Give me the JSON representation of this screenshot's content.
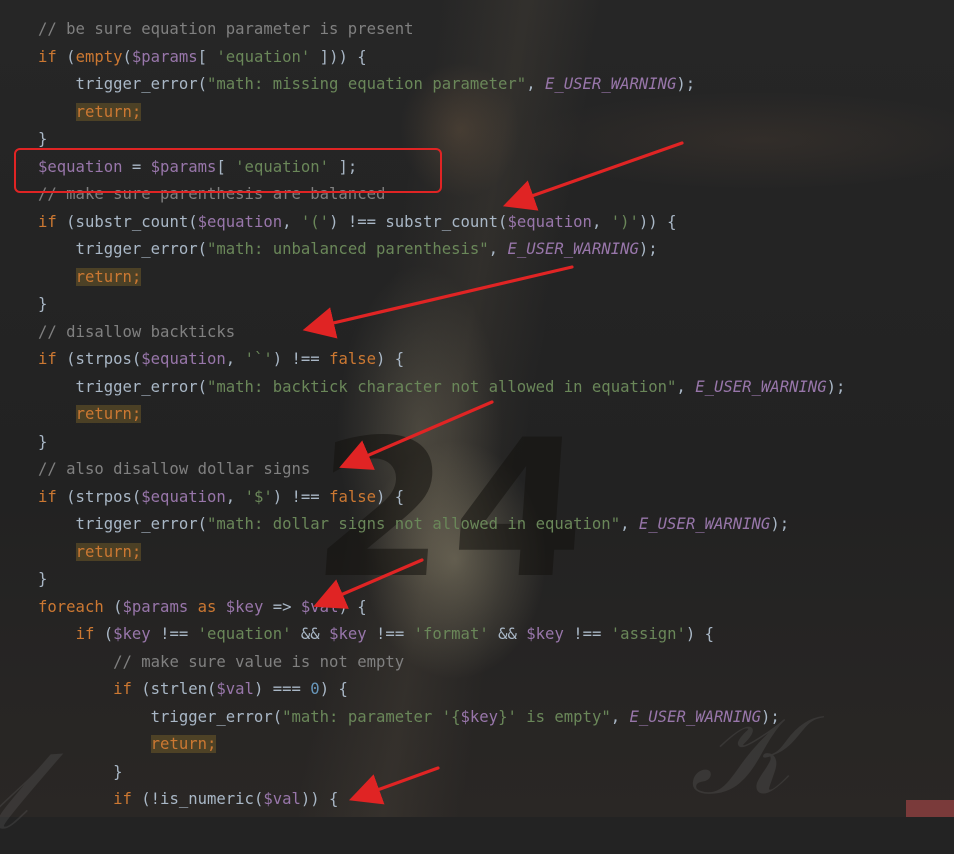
{
  "code_lines": [
    "// be sure equation parameter is present",
    "if (empty($params[ 'equation' ])) {",
    "    trigger_error(\"math: missing equation parameter\", E_USER_WARNING);",
    "    return;",
    "}",
    "$equation = $params[ 'equation' ];",
    "// make sure parenthesis are balanced",
    "if (substr_count($equation, '(') !== substr_count($equation, ')')) {",
    "    trigger_error(\"math: unbalanced parenthesis\", E_USER_WARNING);",
    "    return;",
    "}",
    "// disallow backticks",
    "if (strpos($equation, '`') !== false) {",
    "    trigger_error(\"math: backtick character not allowed in equation\", E_USER_WARNING);",
    "    return;",
    "}",
    "// also disallow dollar signs",
    "if (strpos($equation, '$') !== false) {",
    "    trigger_error(\"math: dollar signs not allowed in equation\", E_USER_WARNING);",
    "    return;",
    "}",
    "foreach ($params as $key => $val) {",
    "    if ($key !== 'equation' && $key !== 'format' && $key !== 'assign') {",
    "        // make sure value is not empty",
    "        if (strlen($val) === 0) {",
    "            trigger_error(\"math: parameter '{$key}' is empty\", E_USER_WARNING);",
    "            return;",
    "        }",
    "        if (!is_numeric($val)) {"
  ],
  "background": {
    "jersey_number": "24"
  },
  "annotations": {
    "box_color": "#e02424",
    "arrow_color": "#e02424",
    "highlighted_line": "$equation = $params[ 'equation' ];"
  }
}
